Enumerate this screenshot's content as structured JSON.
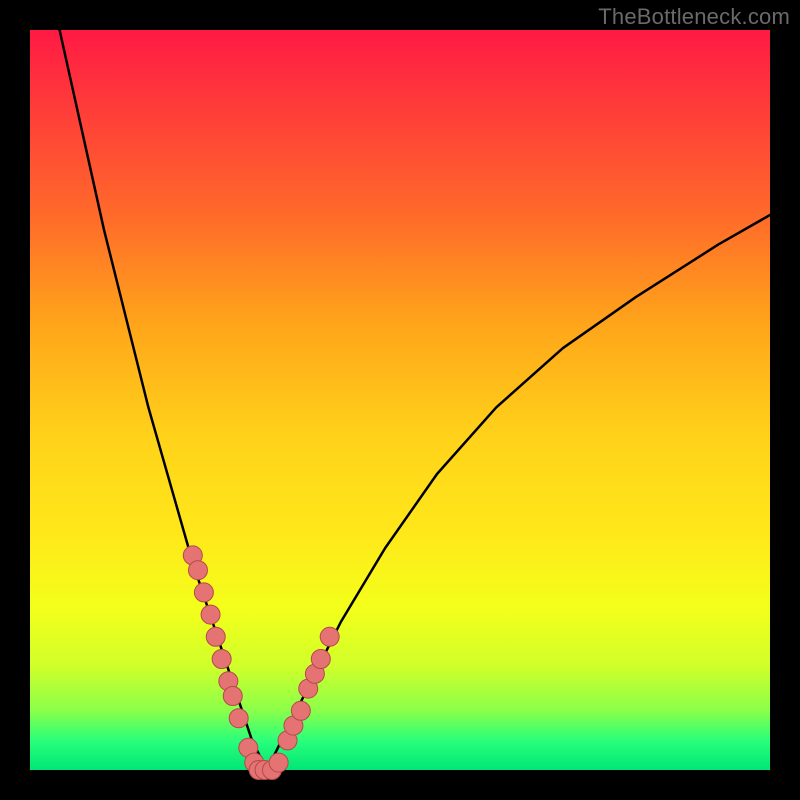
{
  "watermark": "TheBottleneck.com",
  "chart_data": {
    "type": "line",
    "title": "",
    "xlabel": "",
    "ylabel": "",
    "xlim": [
      0,
      100
    ],
    "ylim": [
      0,
      100
    ],
    "grid": false,
    "legend": false,
    "series": [
      {
        "name": "bottleneck-curve",
        "x": [
          4,
          6,
          8,
          10,
          12,
          14,
          16,
          18,
          20,
          22,
          23,
          24,
          25,
          26,
          27,
          28,
          29,
          30,
          31,
          32,
          33,
          35,
          38,
          42,
          48,
          55,
          63,
          72,
          82,
          93,
          100
        ],
        "y": [
          100,
          91,
          82,
          73,
          65,
          57,
          49,
          42,
          35,
          28,
          25,
          22,
          19,
          16,
          13,
          10,
          7,
          4,
          2,
          0,
          2,
          6,
          12,
          20,
          30,
          40,
          49,
          57,
          64,
          71,
          75
        ]
      },
      {
        "name": "highlight-points",
        "type": "scatter",
        "x": [
          22.0,
          22.7,
          23.5,
          24.4,
          25.1,
          25.9,
          26.8,
          27.4,
          28.2,
          29.5,
          30.3,
          30.9,
          31.7,
          32.7,
          33.6,
          34.8,
          35.6,
          36.6,
          37.6,
          38.5,
          39.3,
          40.5
        ],
        "y": [
          29,
          27,
          24,
          21,
          18,
          15,
          12,
          10,
          7,
          3,
          1,
          0,
          0,
          0,
          1,
          4,
          6,
          8,
          11,
          13,
          15,
          18
        ]
      }
    ]
  },
  "colors": {
    "curve": "#000000",
    "points_fill": "#e57373",
    "points_stroke": "#b34a4a"
  }
}
